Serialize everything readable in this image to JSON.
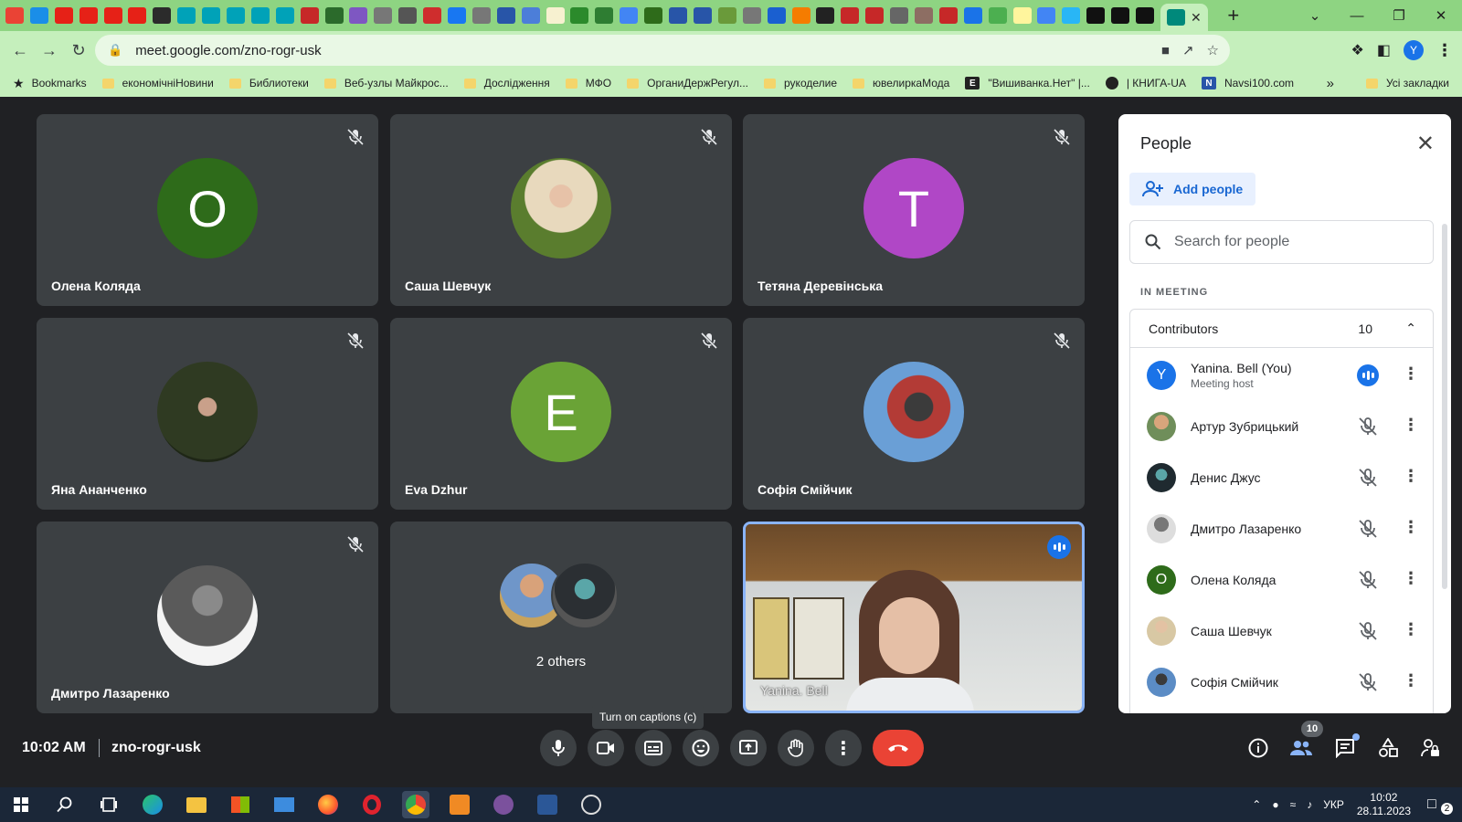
{
  "browser": {
    "url": "meet.google.com/zno-rogr-usk",
    "bookmarks": [
      {
        "label": "Bookmarks",
        "kind": "star"
      },
      {
        "label": "економічніНовини",
        "kind": "folder"
      },
      {
        "label": "Библиотеки",
        "kind": "folder"
      },
      {
        "label": "Веб-узлы Майкрос...",
        "kind": "folder"
      },
      {
        "label": "Дослідження",
        "kind": "folder"
      },
      {
        "label": "МФО",
        "kind": "folder"
      },
      {
        "label": "ОрганиДержРегул...",
        "kind": "folder"
      },
      {
        "label": "рукоделие",
        "kind": "folder"
      },
      {
        "label": "ювелиркаМода",
        "kind": "folder"
      },
      {
        "label": "\"Вишиванка.Нет\" |...",
        "kind": "site-e"
      },
      {
        "label": "| КНИГА-UA",
        "kind": "site-globe"
      },
      {
        "label": "Navsi100.com",
        "kind": "site-n"
      }
    ],
    "bookmarks_all": "Усі закладки",
    "profile_initial": "Y"
  },
  "tiles": [
    {
      "name": "Олена Коляда",
      "initial": "O",
      "color": "#2e6b1a",
      "photo": false
    },
    {
      "name": "Саша Шевчук",
      "initial": "",
      "color": "#6a8a4a",
      "photo": true
    },
    {
      "name": "Тетяна Деревінська",
      "initial": "T",
      "color": "#b047c6",
      "photo": false
    },
    {
      "name": "Яна Ананченко",
      "initial": "",
      "color": "#3e4a2e",
      "photo": true
    },
    {
      "name": "Eva Dzhur",
      "initial": "E",
      "color": "#6aa336",
      "photo": false
    },
    {
      "name": "Софія Смійчик",
      "initial": "",
      "color": "#4a7ab5",
      "photo": true
    },
    {
      "name": "Дмитро Лазаренко",
      "initial": "",
      "color": "#ddd",
      "photo": true
    }
  ],
  "others_tile": {
    "label": "2 others"
  },
  "self_tile": {
    "name": "Yanina. Bell"
  },
  "people_panel": {
    "title": "People",
    "add_people": "Add people",
    "search_placeholder": "Search for people",
    "section": "IN MEETING",
    "group": "Contributors",
    "count": "10",
    "participants": [
      {
        "name": "Yanina. Bell (You)",
        "sub": "Meeting host",
        "initial": "Y",
        "color": "#1a73e8",
        "speaking": true
      },
      {
        "name": "Артур Зубрицький",
        "sub": "",
        "initial": "",
        "color": "#8a8f6a",
        "speaking": false
      },
      {
        "name": "Денис Джус",
        "sub": "",
        "initial": "",
        "color": "#33424a",
        "speaking": false
      },
      {
        "name": "Дмитро Лазаренко",
        "sub": "",
        "initial": "",
        "color": "#9a9a9a",
        "speaking": false
      },
      {
        "name": "Олена Коляда",
        "sub": "",
        "initial": "O",
        "color": "#2e6b1a",
        "speaking": false
      },
      {
        "name": "Саша Шевчук",
        "sub": "",
        "initial": "",
        "color": "#b5a37a",
        "speaking": false
      },
      {
        "name": "Софія Смійчик",
        "sub": "",
        "initial": "",
        "color": "#4a7ab5",
        "speaking": false
      }
    ]
  },
  "bottom_bar": {
    "time": "10:02 AM",
    "meeting_code": "zno-rogr-usk",
    "tooltip": "Turn on captions (c)",
    "people_badge": "10"
  },
  "taskbar": {
    "time": "10:02",
    "date": "28.11.2023",
    "lang": "УКР",
    "notif_count": "2"
  }
}
